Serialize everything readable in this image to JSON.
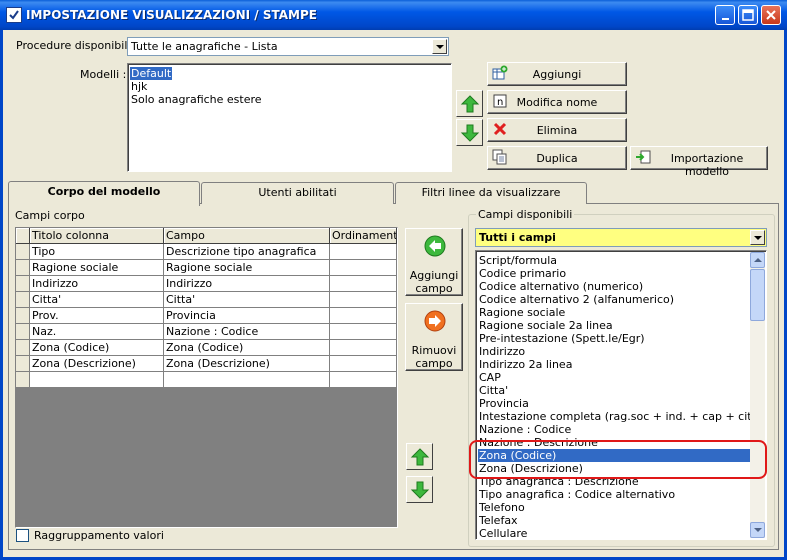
{
  "window": {
    "title": "IMPOSTAZIONE VISUALIZZAZIONI / STAMPE"
  },
  "procedure": {
    "label": "Procedure disponibili :",
    "value": "Tutte le anagrafiche - Lista"
  },
  "modelli": {
    "label": "Modelli :",
    "items": [
      "Default",
      "hjk",
      "Solo anagrafiche estere"
    ],
    "selected_index": 0
  },
  "buttons": {
    "aggiungi": "Aggiungi",
    "modifica_nome": "Modifica nome",
    "elimina": "Elimina",
    "duplica": "Duplica",
    "importazione_modello": "Importazione modello",
    "aggiungi_campo_l1": "Aggiungi",
    "aggiungi_campo_l2": "campo",
    "rimuovi_campo_l1": "Rimuovi",
    "rimuovi_campo_l2": "campo"
  },
  "tabs": [
    "Corpo del modello",
    "Utenti abilitati",
    "Filtri linee da visualizzare"
  ],
  "campi_corpo": {
    "label": "Campi corpo",
    "columns": [
      "Titolo colonna",
      "Campo",
      "Ordinamento"
    ],
    "rows": [
      [
        "Tipo",
        "Descrizione tipo anagrafica",
        ""
      ],
      [
        "Ragione sociale",
        "Ragione sociale",
        ""
      ],
      [
        "Indirizzo",
        "Indirizzo",
        ""
      ],
      [
        "Citta'",
        "Citta'",
        ""
      ],
      [
        "Prov.",
        "Provincia",
        ""
      ],
      [
        "Naz.",
        "Nazione : Codice",
        ""
      ],
      [
        "Zona (Codice)",
        "Zona (Codice)",
        ""
      ],
      [
        "Zona (Descrizione)",
        "Zona (Descrizione)",
        ""
      ],
      [
        "",
        "",
        ""
      ]
    ]
  },
  "campi_disponibili": {
    "label": "Campi disponibili",
    "filter_value": "Tutti i campi",
    "items": [
      "Script/formula",
      "Codice primario",
      "Codice alternativo (numerico)",
      "Codice alternativo 2 (alfanumerico)",
      "Ragione sociale",
      "Ragione sociale 2a linea",
      "Pre-intestazione (Spett.le/Egr)",
      "Indirizzo",
      "Indirizzo 2a linea",
      "CAP",
      "Citta'",
      "Provincia",
      "Intestazione completa (rag.soc + ind. + cap + citta + prov)",
      "Nazione : Codice",
      "Nazione : Descrizione",
      "Zona (Codice)",
      "Zona (Descrizione)",
      "Tipo anagrafica : Descrizione",
      "Tipo anagrafica : Codice alternativo",
      "Telefono",
      "Telefax",
      "Cellulare"
    ],
    "selected_index": 15
  },
  "raggruppamento": {
    "label": "Raggruppamento valori",
    "checked": false
  },
  "colors": {
    "selection": "#316AC5",
    "filter_bg": "#FFFF80",
    "highlight": "#E01818",
    "titlebar": "#0058E6"
  }
}
